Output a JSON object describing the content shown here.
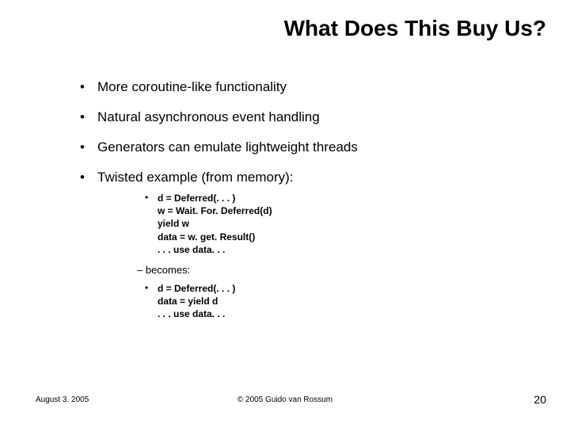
{
  "title": "What Does This Buy Us?",
  "bullets": {
    "b1": "More coroutine-like functionality",
    "b2": "Natural asynchronous event handling",
    "b3": "Generators can emulate lightweight threads",
    "b4": "Twisted example (from memory):"
  },
  "code1": "d = Deferred(. . . )\nw = Wait. For. Deferred(d)\nyield w\ndata = w. get. Result()\n. . . use data. . .",
  "becomes": "becomes:",
  "code2": "d = Deferred(. . . )\ndata = yield d\n. . . use data. . .",
  "footer": {
    "date": "August 3. 2005",
    "copyright": "© 2005 Guido van Rossum",
    "page": "20"
  }
}
